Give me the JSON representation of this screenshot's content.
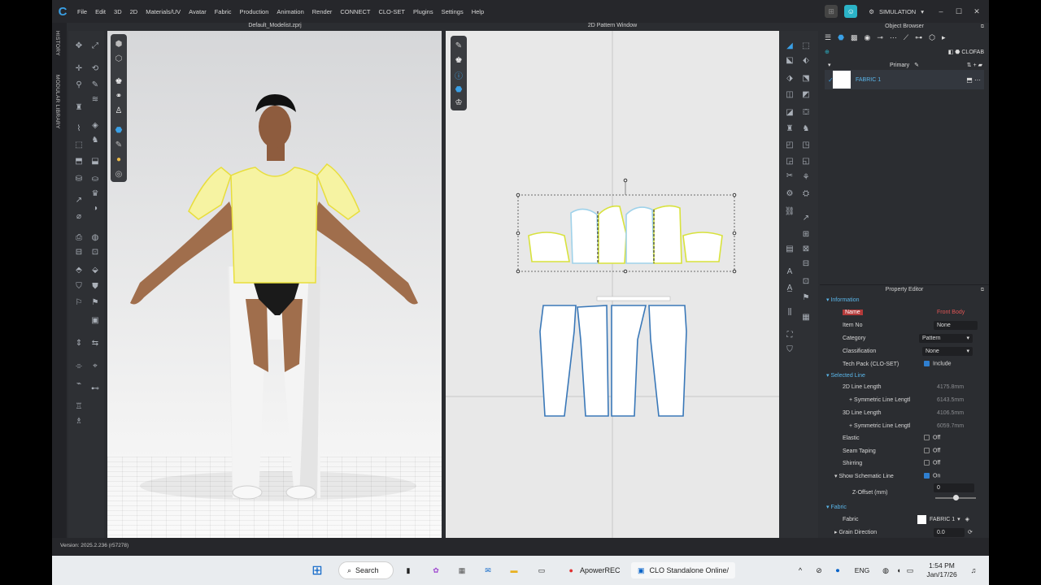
{
  "menubar": {
    "items": [
      "File",
      "Edit",
      "3D",
      "2D",
      "Materials/UV",
      "Avatar",
      "Fabric",
      "Production",
      "Animation",
      "Render",
      "CONNECT",
      "CLO-SET",
      "Plugins",
      "Settings",
      "Help"
    ],
    "mode": "SIMULATION"
  },
  "left_tabs": {
    "history": "HISTORY",
    "modular": "MODULAR LIBRARY"
  },
  "view3d": {
    "title": "Default_Modelist.zprj"
  },
  "view2d": {
    "title": "2D Pattern Window"
  },
  "object_browser": {
    "title": "Object Browser",
    "clofab": "CLOFAB",
    "primary": "Primary",
    "fabric_name": "FABRIC 1"
  },
  "property_editor": {
    "title": "Property Editor",
    "information": "Information",
    "name_label": "Name",
    "name_value": "Front Body",
    "itemno_label": "Item No",
    "itemno_value": "None",
    "category_label": "Category",
    "category_value": "Pattern",
    "classification_label": "Classification",
    "classification_value": "None",
    "techpack_label": "Tech Pack (CLO-SET)",
    "techpack_value": "Include",
    "selected_line": "Selected Line",
    "line2d_label": "2D Line Length",
    "line2d_value": "4175.8mm",
    "sym1_label": "+ Symmetric Line Lengtl",
    "sym1_value": "6143.5mm",
    "line3d_label": "3D Line Length",
    "line3d_value": "4106.5mm",
    "sym2_label": "+ Symmetric Line Lengtl",
    "sym2_value": "6059.7mm",
    "elastic_label": "Elastic",
    "elastic_value": "Off",
    "seam_label": "Seam Taping",
    "seam_value": "Off",
    "shirring_label": "Shirring",
    "shirring_value": "Off",
    "schematic_label": "Show Schematic Line",
    "schematic_value": "On",
    "zoffset_label": "Z-Offset (mm)",
    "zoffset_value": "0",
    "fabric_section": "Fabric",
    "fabric_label": "Fabric",
    "fabric_value": "FABRIC 1",
    "grain_label": "Grain Direction",
    "grain_value": "0.0"
  },
  "status": {
    "version": "Version: 2025.2.236 (r57278)"
  },
  "taskbar": {
    "search": "Search",
    "apowerrec": "ApowerREC",
    "clo": "CLO Standalone Online/",
    "lang": "ENG",
    "time": "1:54 PM",
    "date": "Jan/17/26"
  },
  "colors": {
    "accent": "#5ab6ea",
    "garment_yellow": "#f6f3a2",
    "name_red": "#e05555"
  }
}
